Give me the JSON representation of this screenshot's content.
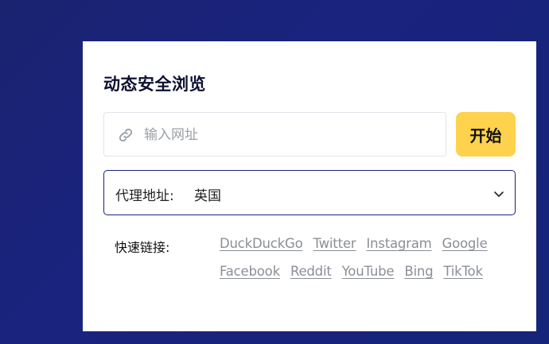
{
  "card": {
    "title": "动态安全浏览"
  },
  "url_input": {
    "placeholder": "输入网址",
    "value": "",
    "icon": "link-icon"
  },
  "start_button": {
    "label": "开始",
    "color": "#ffd24d"
  },
  "proxy": {
    "label": "代理地址:",
    "selected": "英国",
    "icon": "chevron-down-icon"
  },
  "quick_links": {
    "label": "快速链接:",
    "items": [
      "DuckDuckGo",
      "Twitter",
      "Instagram",
      "Google",
      "Facebook",
      "Reddit",
      "YouTube",
      "Bing",
      "TikTok"
    ]
  },
  "colors": {
    "background": "#1a237e",
    "accent": "#ffd24d",
    "link": "#8a8f96"
  }
}
